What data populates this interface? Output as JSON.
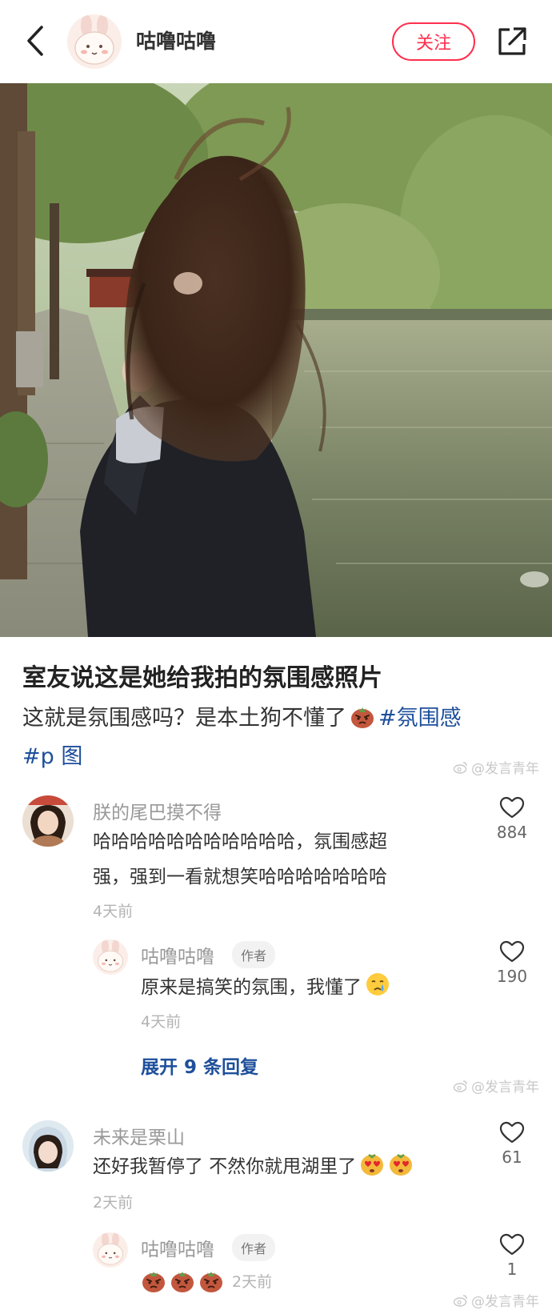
{
  "header": {
    "author_name": "咕噜咕噜",
    "follow_label": "关注"
  },
  "post": {
    "title": "室友说这是她给我拍的氛围感照片",
    "body_line1": "这就是氛围感吗？是本土狗不懂了",
    "tag1": "#氛围感",
    "tag2": "#p 图"
  },
  "watermark": {
    "text": "@发言青年"
  },
  "comments": [
    {
      "username": "朕的尾巴摸不得",
      "text_line1": "哈哈哈哈哈哈哈哈哈哈哈，氛围感超",
      "text_line2": "强，强到一看就想笑哈哈哈哈哈哈哈",
      "time": "4天前",
      "likes": "884",
      "replies": [
        {
          "username": "咕噜咕噜",
          "badge": "作者",
          "text": "原来是搞笑的氛围，我懂了",
          "time": "4天前",
          "likes": "190"
        }
      ],
      "expand_label": "展开 9 条回复"
    },
    {
      "username": "未来是栗山",
      "text": "还好我暂停了 不然你就甩湖里了",
      "time": "2天前",
      "likes": "61",
      "replies": [
        {
          "username": "咕噜咕噜",
          "badge": "作者",
          "time": "2天前",
          "likes": "1"
        }
      ]
    }
  ],
  "colors": {
    "accent_red": "#ff2e4d",
    "tag_blue": "#1e4f9b"
  }
}
